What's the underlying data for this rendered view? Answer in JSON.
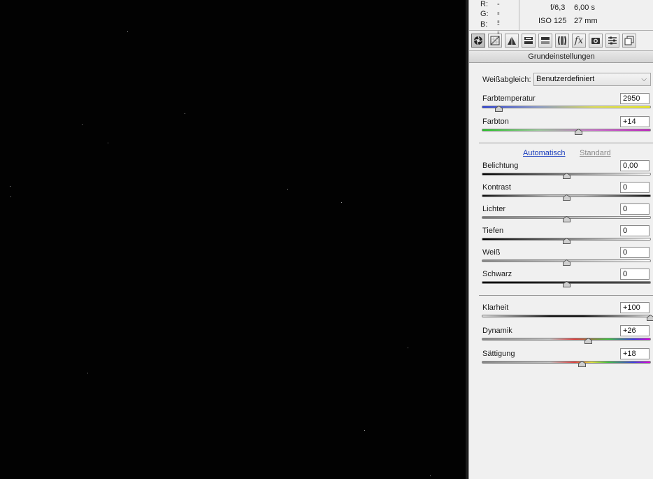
{
  "info": {
    "rgb": [
      {
        "label": "R:",
        "value": "---"
      },
      {
        "label": "G:",
        "value": "---"
      },
      {
        "label": "B:",
        "value": "---"
      }
    ],
    "aperture": "f/6,3",
    "shutter": "6,00 s",
    "iso": "ISO 125",
    "focal": "27 mm"
  },
  "toolbar": {
    "icons": [
      "aperture-icon",
      "tone-curve-icon",
      "detail-icon",
      "hsl-icon",
      "split-toning-icon",
      "lens-correction-icon",
      "fx-icon",
      "camera-calibration-icon",
      "presets-icon",
      "snapshots-icon"
    ]
  },
  "section": {
    "title": "Grundeinstellungen"
  },
  "white_balance": {
    "label": "Weißabgleich:",
    "value": "Benutzerdefiniert"
  },
  "sliders_wb": [
    {
      "label": "Farbtemperatur",
      "value": "2950",
      "pos": 0.1
    },
    {
      "label": "Farbton",
      "value": "+14",
      "pos": 0.57
    }
  ],
  "auto": {
    "automatic": "Automatisch",
    "default": "Standard"
  },
  "sliders_tone": [
    {
      "label": "Belichtung",
      "value": "0,00",
      "pos": 0.5
    },
    {
      "label": "Kontrast",
      "value": "0",
      "pos": 0.5
    },
    {
      "label": "Lichter",
      "value": "0",
      "pos": 0.5
    },
    {
      "label": "Tiefen",
      "value": "0",
      "pos": 0.5
    },
    {
      "label": "Weiß",
      "value": "0",
      "pos": 0.5
    },
    {
      "label": "Schwarz",
      "value": "0",
      "pos": 0.5
    }
  ],
  "sliders_presence": [
    {
      "label": "Klarheit",
      "value": "+100",
      "pos": 1.0
    },
    {
      "label": "Dynamik",
      "value": "+26",
      "pos": 0.63
    },
    {
      "label": "Sättigung",
      "value": "+18",
      "pos": 0.59
    }
  ],
  "colors": {
    "link": "#1a3dbd",
    "muted_link": "#8a8a8a"
  }
}
